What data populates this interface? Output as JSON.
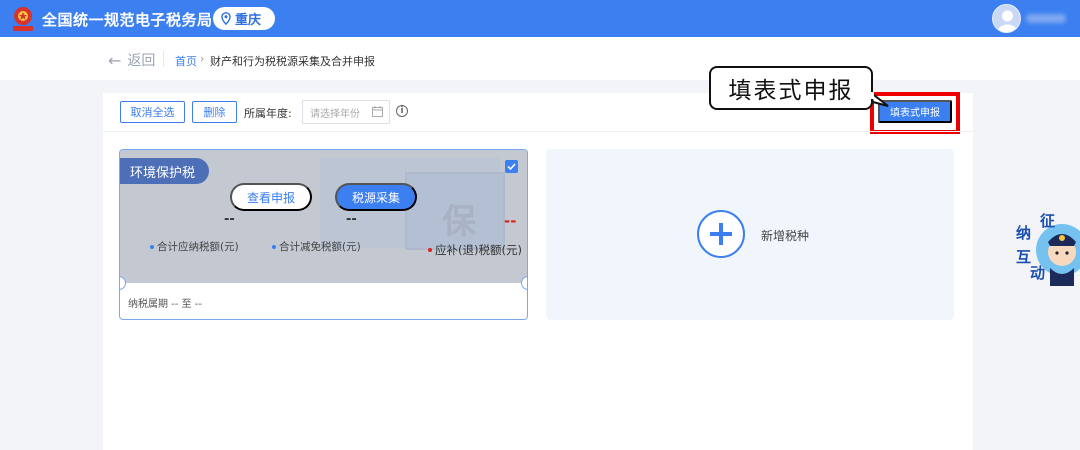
{
  "header": {
    "site_title": "全国统一规范电子税务局",
    "city": "重庆",
    "brand_color": "#3b7ff0"
  },
  "breadcrumb": {
    "back_label": "返回",
    "home": "首页",
    "separator": "›",
    "current": "财产和行为税税源采集及合并申报"
  },
  "toolbar": {
    "cancel_select_label": "取消全选",
    "delete_label": "删除",
    "year_label": "所属年度:",
    "year_placeholder": "请选择年份",
    "fill_form_label": "填表式申报"
  },
  "tax_card": {
    "tag": "环境保护税",
    "bg_glyph": "保",
    "view_button": "查看申报",
    "source_button": "税源采集",
    "values": [
      "--",
      "--",
      "--"
    ],
    "metrics": [
      "合计应纳税额(元)",
      "合计减免税额(元)",
      "应补(退)税额(元)"
    ],
    "period": "纳税属期 -- 至 --"
  },
  "add_card": {
    "label": "新增税种"
  },
  "annotation": {
    "text": "填表式申报",
    "frame_color": "#ee0000"
  },
  "mascot": {
    "chars": [
      "征",
      "纳",
      "互",
      "动"
    ]
  }
}
